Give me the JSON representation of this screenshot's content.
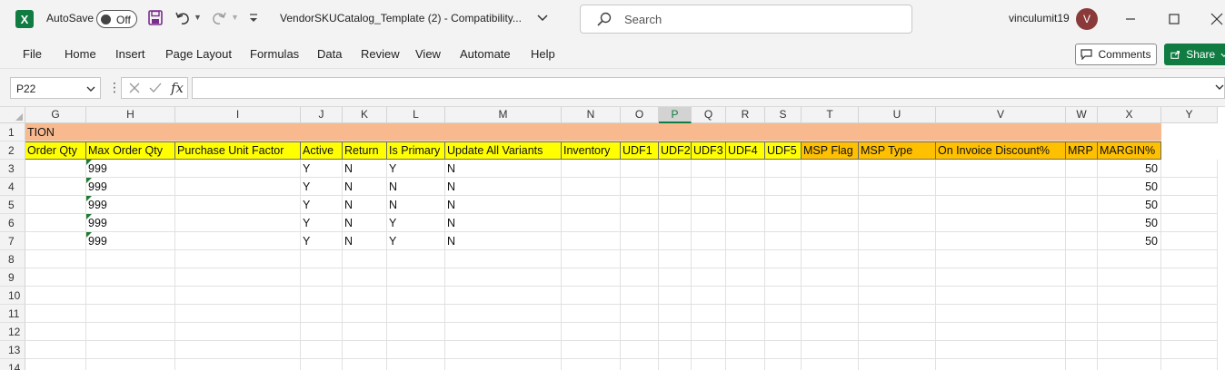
{
  "titlebar": {
    "autosave_label": "AutoSave",
    "autosave_state": "Off",
    "document_title": "VendorSKUCatalog_Template (2)  -  Compatibility...",
    "search_placeholder": "Search",
    "username": "vinculumit19",
    "avatar_initial": "V",
    "excel_letter": "X"
  },
  "ribbon": {
    "tabs": [
      "File",
      "Home",
      "Insert",
      "Page Layout",
      "Formulas",
      "Data",
      "Review",
      "View",
      "Automate",
      "Help"
    ],
    "comments_label": "Comments",
    "share_label": "Share"
  },
  "formula_bar": {
    "name_box": "P22",
    "fx_label": "fx",
    "content": ""
  },
  "sheet": {
    "columns": [
      "G",
      "H",
      "I",
      "J",
      "K",
      "L",
      "M",
      "N",
      "O",
      "P",
      "Q",
      "R",
      "S",
      "T",
      "U",
      "V",
      "W",
      "X",
      "Y"
    ],
    "selected_column": "P",
    "rows": [
      "1",
      "2",
      "3",
      "4",
      "5",
      "6",
      "7",
      "8",
      "9",
      "10",
      "11",
      "12",
      "13",
      "14"
    ],
    "banner_text": "TION",
    "headers": [
      "Order Qty",
      "Max Order Qty",
      "Purchase Unit Factor",
      "Active",
      "Return",
      "Is Primary",
      "Update All Variants",
      "Inventory",
      "UDF1",
      "UDF2",
      "UDF3",
      "UDF4",
      "UDF5",
      "MSP Flag",
      "MSP Type",
      "On Invoice Discount%",
      "MRP",
      "MARGIN%"
    ],
    "data_rows": [
      {
        "max_order_qty": "999",
        "active": "Y",
        "return": "N",
        "is_primary": "Y",
        "update_all": "N",
        "margin": "50"
      },
      {
        "max_order_qty": "999",
        "active": "Y",
        "return": "N",
        "is_primary": "N",
        "update_all": "N",
        "margin": "50"
      },
      {
        "max_order_qty": "999",
        "active": "Y",
        "return": "N",
        "is_primary": "N",
        "update_all": "N",
        "margin": "50"
      },
      {
        "max_order_qty": "999",
        "active": "Y",
        "return": "N",
        "is_primary": "Y",
        "update_all": "N",
        "margin": "50"
      },
      {
        "max_order_qty": "999",
        "active": "Y",
        "return": "N",
        "is_primary": "Y",
        "update_all": "N",
        "margin": "50"
      }
    ]
  },
  "colors": {
    "excel_green": "#107c41",
    "banner_orange": "#f8b98f",
    "header_yellow": "#ffff00",
    "header_orange": "#ffc000"
  }
}
